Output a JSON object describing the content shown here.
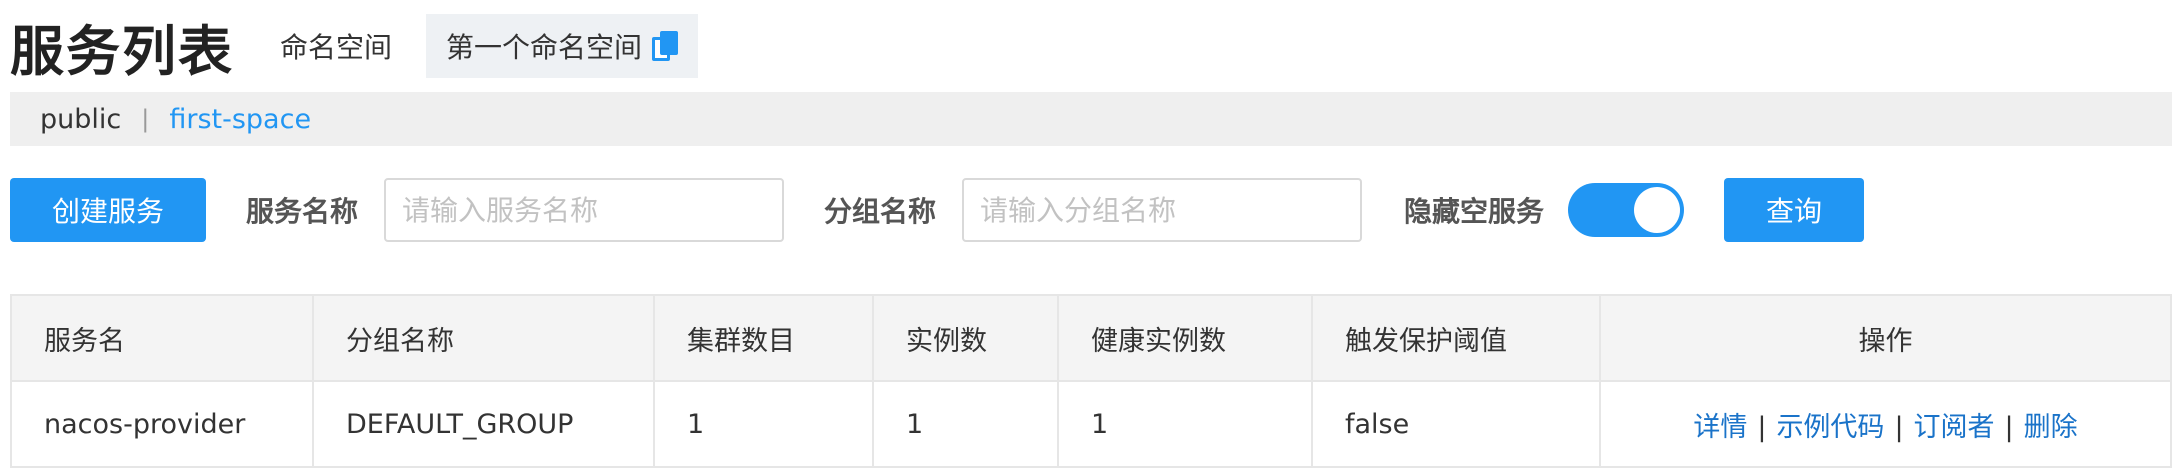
{
  "header": {
    "title": "服务列表",
    "namespace_label": "命名空间",
    "current_namespace": "第一个命名空间"
  },
  "namespaces": [
    {
      "label": "public",
      "active": false
    },
    {
      "label": "first-space",
      "active": true
    }
  ],
  "filters": {
    "create_button": "创建服务",
    "service_name_label": "服务名称",
    "service_name_placeholder": "请输入服务名称",
    "group_name_label": "分组名称",
    "group_name_placeholder": "请输入分组名称",
    "hide_empty_label": "隐藏空服务",
    "hide_empty_on": true,
    "query_button": "查询"
  },
  "table": {
    "columns": [
      "服务名",
      "分组名称",
      "集群数目",
      "实例数",
      "健康实例数",
      "触发保护阈值",
      "操作"
    ],
    "rows": [
      {
        "service_name": "nacos-provider",
        "group_name": "DEFAULT_GROUP",
        "cluster_count": "1",
        "instance_count": "1",
        "healthy_instance_count": "1",
        "protect_threshold": "false",
        "ops": [
          "详情",
          "示例代码",
          "订阅者",
          "删除"
        ]
      }
    ]
  },
  "colors": {
    "primary": "#2196f3",
    "link": "#1a73c9",
    "bar_bg": "#efefef"
  },
  "icons": {
    "copy": "copy-icon"
  }
}
